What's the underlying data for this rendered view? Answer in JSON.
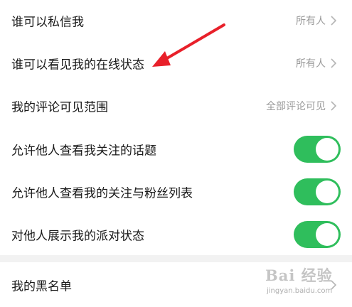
{
  "settings": {
    "items": [
      {
        "label": "谁可以私信我",
        "value": "所有人"
      },
      {
        "label": "谁可以看见我的在线状态",
        "value": "所有人"
      },
      {
        "label": "我的评论可见范围",
        "value": "全部评论可见"
      },
      {
        "label": "允许他人查看我关注的话题",
        "toggle_on": true
      },
      {
        "label": "允许他人查看我的关注与粉丝列表",
        "toggle_on": true
      },
      {
        "label": "对他人展示我的派对状态",
        "toggle_on": true
      }
    ],
    "blacklist": {
      "label": "我的黑名单"
    }
  },
  "colors": {
    "toggle_on": "#2fbe5c",
    "annotation_arrow": "#e8202a",
    "text_primary": "#1a1a1a",
    "text_secondary": "#9a9a9a",
    "section_gap": "#f2f2f2"
  },
  "icons": {
    "chevron": "chevron-right-icon",
    "annotation": "red-arrow-annotation"
  },
  "watermark": {
    "logo_text": "Bai 经验",
    "url_text": "jingyan.baidu.com"
  }
}
